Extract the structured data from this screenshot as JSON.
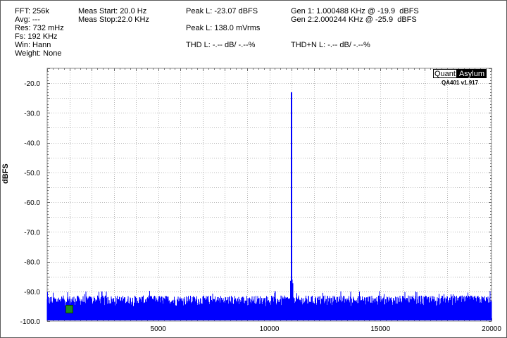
{
  "info": {
    "fft": "FFT: 256k",
    "avg": "Avg: ---",
    "res": "Res: 732 mHz",
    "fs": "Fs: 192 KHz",
    "win": "Win: Hann",
    "weight": "Weight: None",
    "meas_start": "Meas Start: 20.0 Hz",
    "meas_stop": "Meas Stop:22.0 KHz",
    "peak_dbfs": "Peak L: -23.07 dBFS",
    "peak_mvrms": "Peak L: 138.0 mVrms",
    "thd": "THD L: -.-- dB/ -.--%",
    "thdn": "THD+N L: -.-- dB/ -.--%",
    "gen1": "Gen 1: 1.000488 KHz @ -19.9  dBFS",
    "gen2": "Gen 2:2.000244 KHz @ -25.9  dBFS"
  },
  "logo": {
    "part1": "Quant",
    "part2": "Asylum",
    "version": "QA401 v1.917"
  },
  "chart_data": {
    "type": "line",
    "ylabel": "dBFS",
    "xlabel": "",
    "xlim": [
      0,
      20000
    ],
    "ylim": [
      -100,
      -15
    ],
    "x_ticks": [
      "5000",
      "10000",
      "15000",
      "20000"
    ],
    "x_tick_values": [
      5000,
      10000,
      15000,
      20000
    ],
    "y_ticks": [
      "-20.0",
      "-30.0",
      "-40.0",
      "-50.0",
      "-60.0",
      "-70.0",
      "-80.0",
      "-90.0",
      "-100.0"
    ],
    "y_tick_values": [
      -20,
      -30,
      -40,
      -50,
      -60,
      -70,
      -80,
      -90,
      -100
    ],
    "grid": true,
    "series": [
      {
        "color": "#0000ff",
        "noise_floor_dbfs": -95,
        "noise_peak_dbfs": -91,
        "peak": {
          "x": 11000,
          "y": -23.07
        }
      }
    ]
  }
}
